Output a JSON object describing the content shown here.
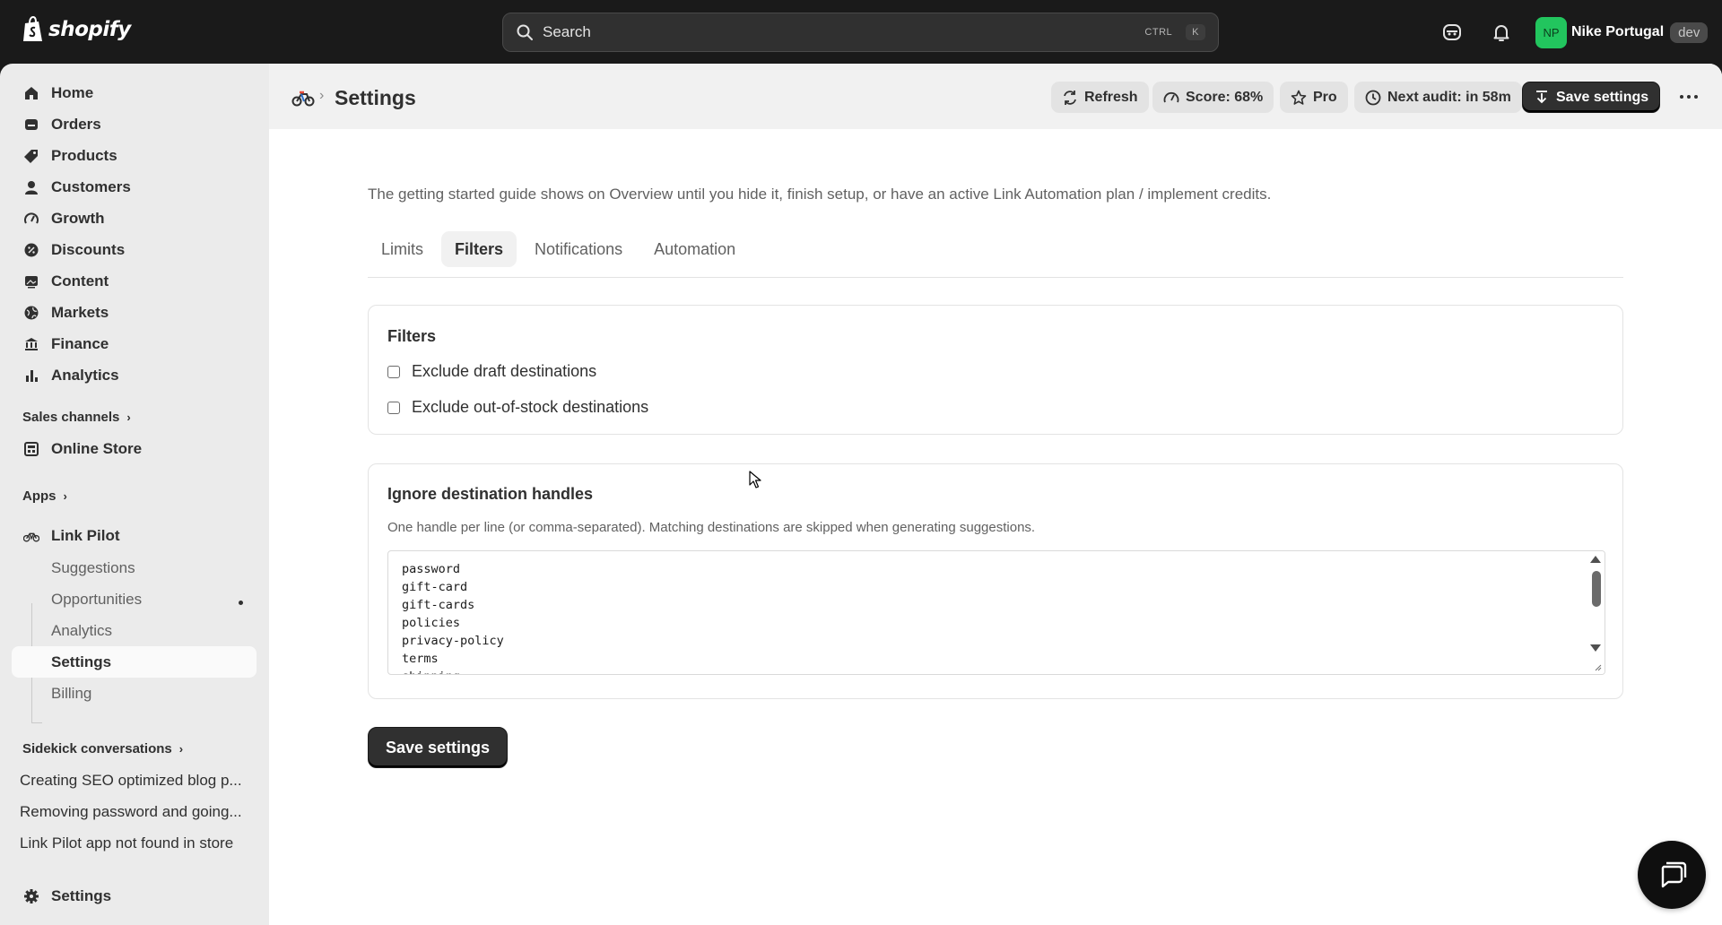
{
  "topbar": {
    "logo_text": "shopify",
    "search_placeholder": "Search",
    "shortcut_mod": "CTRL",
    "shortcut_key": "K",
    "account_initials": "NP",
    "account_name": "Nike Portugal",
    "account_badge": "dev"
  },
  "sidebar": {
    "items": [
      {
        "label": "Home",
        "icon": "home-icon"
      },
      {
        "label": "Orders",
        "icon": "orders-icon"
      },
      {
        "label": "Products",
        "icon": "tag-icon"
      },
      {
        "label": "Customers",
        "icon": "person-icon"
      },
      {
        "label": "Growth",
        "icon": "gauge-icon"
      },
      {
        "label": "Discounts",
        "icon": "discount-icon"
      },
      {
        "label": "Content",
        "icon": "image-icon"
      },
      {
        "label": "Markets",
        "icon": "globe-icon"
      },
      {
        "label": "Finance",
        "icon": "bank-icon"
      },
      {
        "label": "Analytics",
        "icon": "bar-chart-icon"
      }
    ],
    "sales_channels_label": "Sales channels",
    "online_store_label": "Online Store",
    "apps_label": "Apps",
    "app_name": "Link Pilot",
    "app_sub_items": [
      "Suggestions",
      "Opportunities",
      "Analytics",
      "Settings",
      "Billing"
    ],
    "sidekick_label": "Sidekick conversations",
    "conversations": [
      "Creating SEO optimized blog p...",
      "Removing password and going...",
      "Link Pilot app not found in store"
    ],
    "settings_label": "Settings"
  },
  "header": {
    "title": "Settings",
    "refresh_label": "Refresh",
    "score_label": "Score: 68%",
    "pro_label": "Pro",
    "next_audit_label": "Next audit: in 58m",
    "save_label": "Save settings"
  },
  "main": {
    "intro": "The getting started guide shows on Overview until you hide it, finish setup, or have an active Link Automation plan / implement credits.",
    "tabs": [
      "Limits",
      "Filters",
      "Notifications",
      "Automation"
    ],
    "active_tab": "Filters",
    "filters_card": {
      "title": "Filters",
      "options": [
        "Exclude draft destinations",
        "Exclude out-of-stock destinations"
      ]
    },
    "ignore_card": {
      "title": "Ignore destination handles",
      "help": "One handle per line (or comma-separated). Matching destinations are skipped when generating suggestions.",
      "handles": [
        "password",
        "gift-card",
        "gift-cards",
        "policies",
        "privacy-policy",
        "terms",
        "shipping"
      ]
    },
    "save_label": "Save settings"
  },
  "colors": {
    "topbar": "#1a1a1a",
    "sidebar": "#ebebeb",
    "primary_button": "#303030",
    "avatar": "#22c55e"
  }
}
